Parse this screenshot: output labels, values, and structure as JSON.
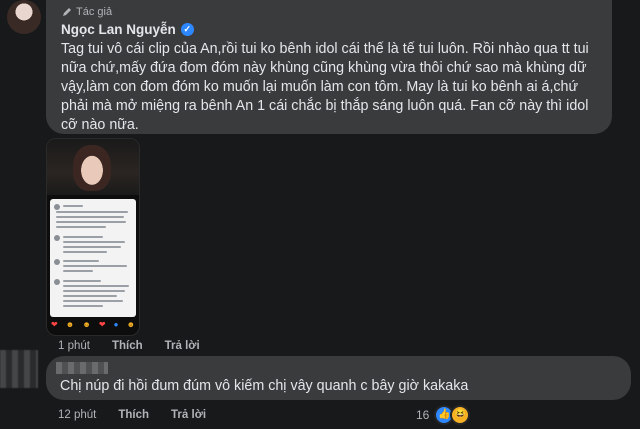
{
  "comment1": {
    "author_tag": "Tác giả",
    "author_name": "Ngọc Lan Nguyễn",
    "text": "Tag tui vô cái clip của An,rồi tui ko bênh idol cái thế là tế tui luôn. Rồi nhào qua tt tui nữa chứ,mấy đứa đom đóm này khùng cũng khùng vừa thôi chứ sao mà khùng dữ vậy,làm con đom đóm ko muốn lại muốn làm con tôm. May là tui ko bênh ai á,chứ phải mà mở miệng ra bênh An 1 cái chắc bị thắp sáng luôn quá. Fan cỡ này thì idol cỡ nào nữa.",
    "time": "1 phút",
    "like_label": "Thích",
    "reply_label": "Trả lời"
  },
  "comment2": {
    "text": "Chị núp đi hồi đum đúm vô kiếm chị vây quanh c bây giờ kakaka",
    "time": "12 phút",
    "like_label": "Thích",
    "reply_label": "Trả lời",
    "reaction_count": "16"
  },
  "icons": {
    "author_tag_icon": "pen-icon",
    "verified": "verified-badge-icon",
    "reactions": [
      "like-icon",
      "haha-icon"
    ]
  },
  "colors": {
    "background": "#18191a",
    "bubble": "#3a3b3c",
    "verified": "#2d88ff"
  }
}
